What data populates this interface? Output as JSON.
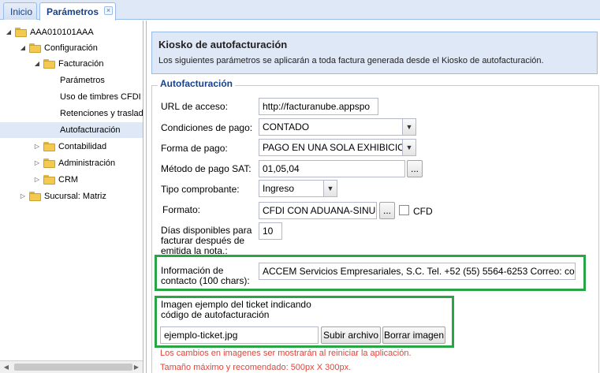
{
  "tabs": [
    {
      "label": "Inicio"
    },
    {
      "label": "Parámetros",
      "close": "×"
    }
  ],
  "tree": {
    "items": [
      {
        "label": "AAA010101AAA"
      },
      {
        "label": "Configuración"
      },
      {
        "label": "Facturación"
      },
      {
        "label": "Parámetros"
      },
      {
        "label": "Uso de timbres CFDI"
      },
      {
        "label": "Retenciones y traslad"
      },
      {
        "label": "Autofacturación"
      },
      {
        "label": "Contabilidad"
      },
      {
        "label": "Administración"
      },
      {
        "label": "CRM"
      },
      {
        "label": "Sucursal: Matriz"
      }
    ]
  },
  "header": {
    "title": "Kiosko de autofacturación",
    "subtitle": "Los siguientes parámetros se aplicarán a toda factura generada desde el Kiosko de autofacturación."
  },
  "form": {
    "legend": "Autofacturación",
    "url_label": "URL de acceso:",
    "url_value": "http://facturanube.appspo",
    "condiciones_label": "Condiciones de pago:",
    "condiciones_value": "CONTADO",
    "forma_label": "Forma de pago:",
    "forma_value": "PAGO EN UNA SOLA EXHIBICION",
    "metodo_label": "Método de pago SAT:",
    "metodo_value": "01,05,04",
    "tipo_label": "Tipo comprobante:",
    "tipo_value": "Ingreso",
    "formato_label": "Formato:",
    "formato_value": "CFDI CON ADUANA-SINUBE",
    "cfd_label": "CFD",
    "dias_label_1": "Días disponibles para",
    "dias_label_2": "facturar después de",
    "dias_label_3": "emitida la nota.:",
    "dias_value": "10",
    "info_label_1": "Información de",
    "info_label_2": "contacto (100 chars):",
    "info_value": "ACCEM Servicios Empresariales, S.C. Tel. +52 (55) 5564-6253 Correo: co",
    "imagen_label_1": "Imagen ejemplo del ticket indicando",
    "imagen_label_2": "código de autofacturación",
    "imagen_value": "ejemplo-ticket.jpg",
    "subir_label": "Subir archivo",
    "borrar_label": "Borrar imagen",
    "ellipsis": "...",
    "note_1": "Los cambios en imagenes ser mostrarán al reiniciar la aplicación.",
    "note_2": "Tamaño máximo y recomendado: 500px X 300px."
  },
  "colors": {
    "accent": "#15428b",
    "highlight": "#2aa546",
    "note": "#e2453a",
    "panel": "#dfe8f6"
  },
  "icons": {
    "folder": "folder-icon",
    "expand": "triangle-icon",
    "dropdown": "chevron-down-icon",
    "close": "close-icon"
  }
}
